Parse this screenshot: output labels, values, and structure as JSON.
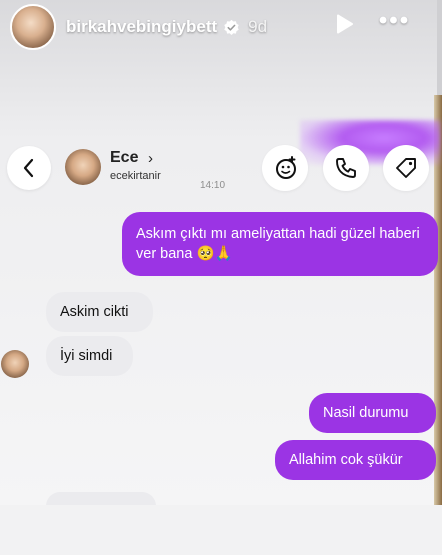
{
  "story": {
    "username": "birkahvebingiybett",
    "time_ago": "9d",
    "more_label": "•••"
  },
  "chat": {
    "contact_name": "Ece",
    "chevron": "›",
    "contact_handle": "ecekirtanir",
    "timestamp": "14:10"
  },
  "messages": [
    {
      "side": "sent",
      "text": "Askım çıktı mı ameliyattan hadi güzel haberi ver bana 🥺🙏"
    },
    {
      "side": "received",
      "text": "Askim cikti"
    },
    {
      "side": "received",
      "text": "İyi simdi"
    },
    {
      "side": "sent",
      "text": "Nasil durumu"
    },
    {
      "side": "sent",
      "text": "Allahim cok şükür"
    }
  ],
  "colors": {
    "sent_bubble": "#9b34e4",
    "received_bubble": "#ebebee",
    "accent": "#b35cf0"
  },
  "icons": {
    "verified": "verified-badge-icon",
    "play": "play-icon",
    "back": "chevron-left-icon",
    "video_effects": "video-effects-icon",
    "call": "phone-icon",
    "tag": "tag-icon"
  }
}
